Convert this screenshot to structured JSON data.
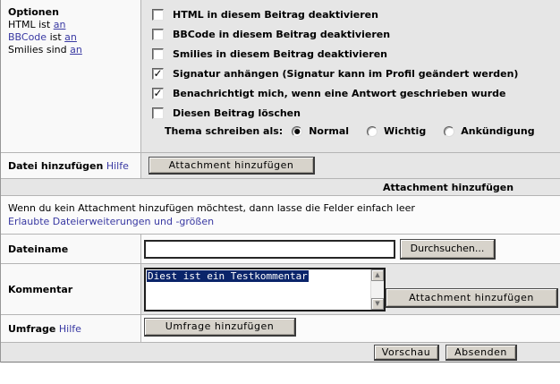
{
  "colors": {
    "link": "#3838a2",
    "selection_bg": "#0a246a",
    "row_gray": "#e6e6e6",
    "row_light": "#fbfbfb",
    "button_face": "#d7d3cb"
  },
  "options_panel": {
    "title": "Optionen",
    "status_lines": {
      "html_prefix": "HTML ist",
      "html_link": "an",
      "bbcode_word": "BBCode",
      "bbcode_middle": "ist",
      "bbcode_link": "an",
      "smilies_prefix": "Smilies sind",
      "smilies_link": "an"
    },
    "checkboxes": [
      {
        "label": "HTML in diesem Beitrag deaktivieren",
        "checked": false,
        "glyph": ""
      },
      {
        "label": "BBCode in diesem Beitrag deaktivieren",
        "checked": false,
        "glyph": ""
      },
      {
        "label": "Smilies in diesem Beitrag deaktivieren",
        "checked": false,
        "glyph": ""
      },
      {
        "label": "Signatur anhängen (Signatur kann im Profil geändert werden)",
        "checked": true,
        "glyph": "✓"
      },
      {
        "label": "Benachrichtigt mich, wenn eine Antwort geschrieben wurde",
        "checked": true,
        "glyph": "✓"
      },
      {
        "label": "Diesen Beitrag löschen",
        "checked": false,
        "glyph": ""
      }
    ],
    "post_as": {
      "label": "Thema schreiben als:",
      "options": [
        {
          "label": "Normal",
          "selected": true,
          "glyph": "●"
        },
        {
          "label": "Wichtig",
          "selected": false,
          "glyph": ""
        },
        {
          "label": "Ankündigung",
          "selected": false,
          "glyph": ""
        }
      ]
    }
  },
  "attach_row": {
    "label": "Datei hinzufügen",
    "help_link": "Hilfe",
    "button": "Attachment hinzufügen"
  },
  "attachment_panel": {
    "header": "Attachment hinzufügen",
    "info_text": "Wenn du kein Attachment hinzufügen möchtest, dann lasse die Felder einfach leer",
    "info_link": "Erlaubte Dateierweiterungen und -größen",
    "filename": {
      "label": "Dateiname",
      "value": "",
      "browse_button": "Durchsuchen..."
    },
    "comment": {
      "label": "Kommentar",
      "selected_text": "Diest ist ein Testkommentar",
      "button": "Attachment hinzufügen"
    },
    "poll": {
      "label": "Umfrage",
      "help_link": "Hilfe",
      "button": "Umfrage hinzufügen"
    }
  },
  "icons": {
    "scroll_up": "▲",
    "scroll_down": "▼"
  },
  "footer": {
    "preview_button": "Vorschau",
    "submit_button": "Absenden"
  }
}
